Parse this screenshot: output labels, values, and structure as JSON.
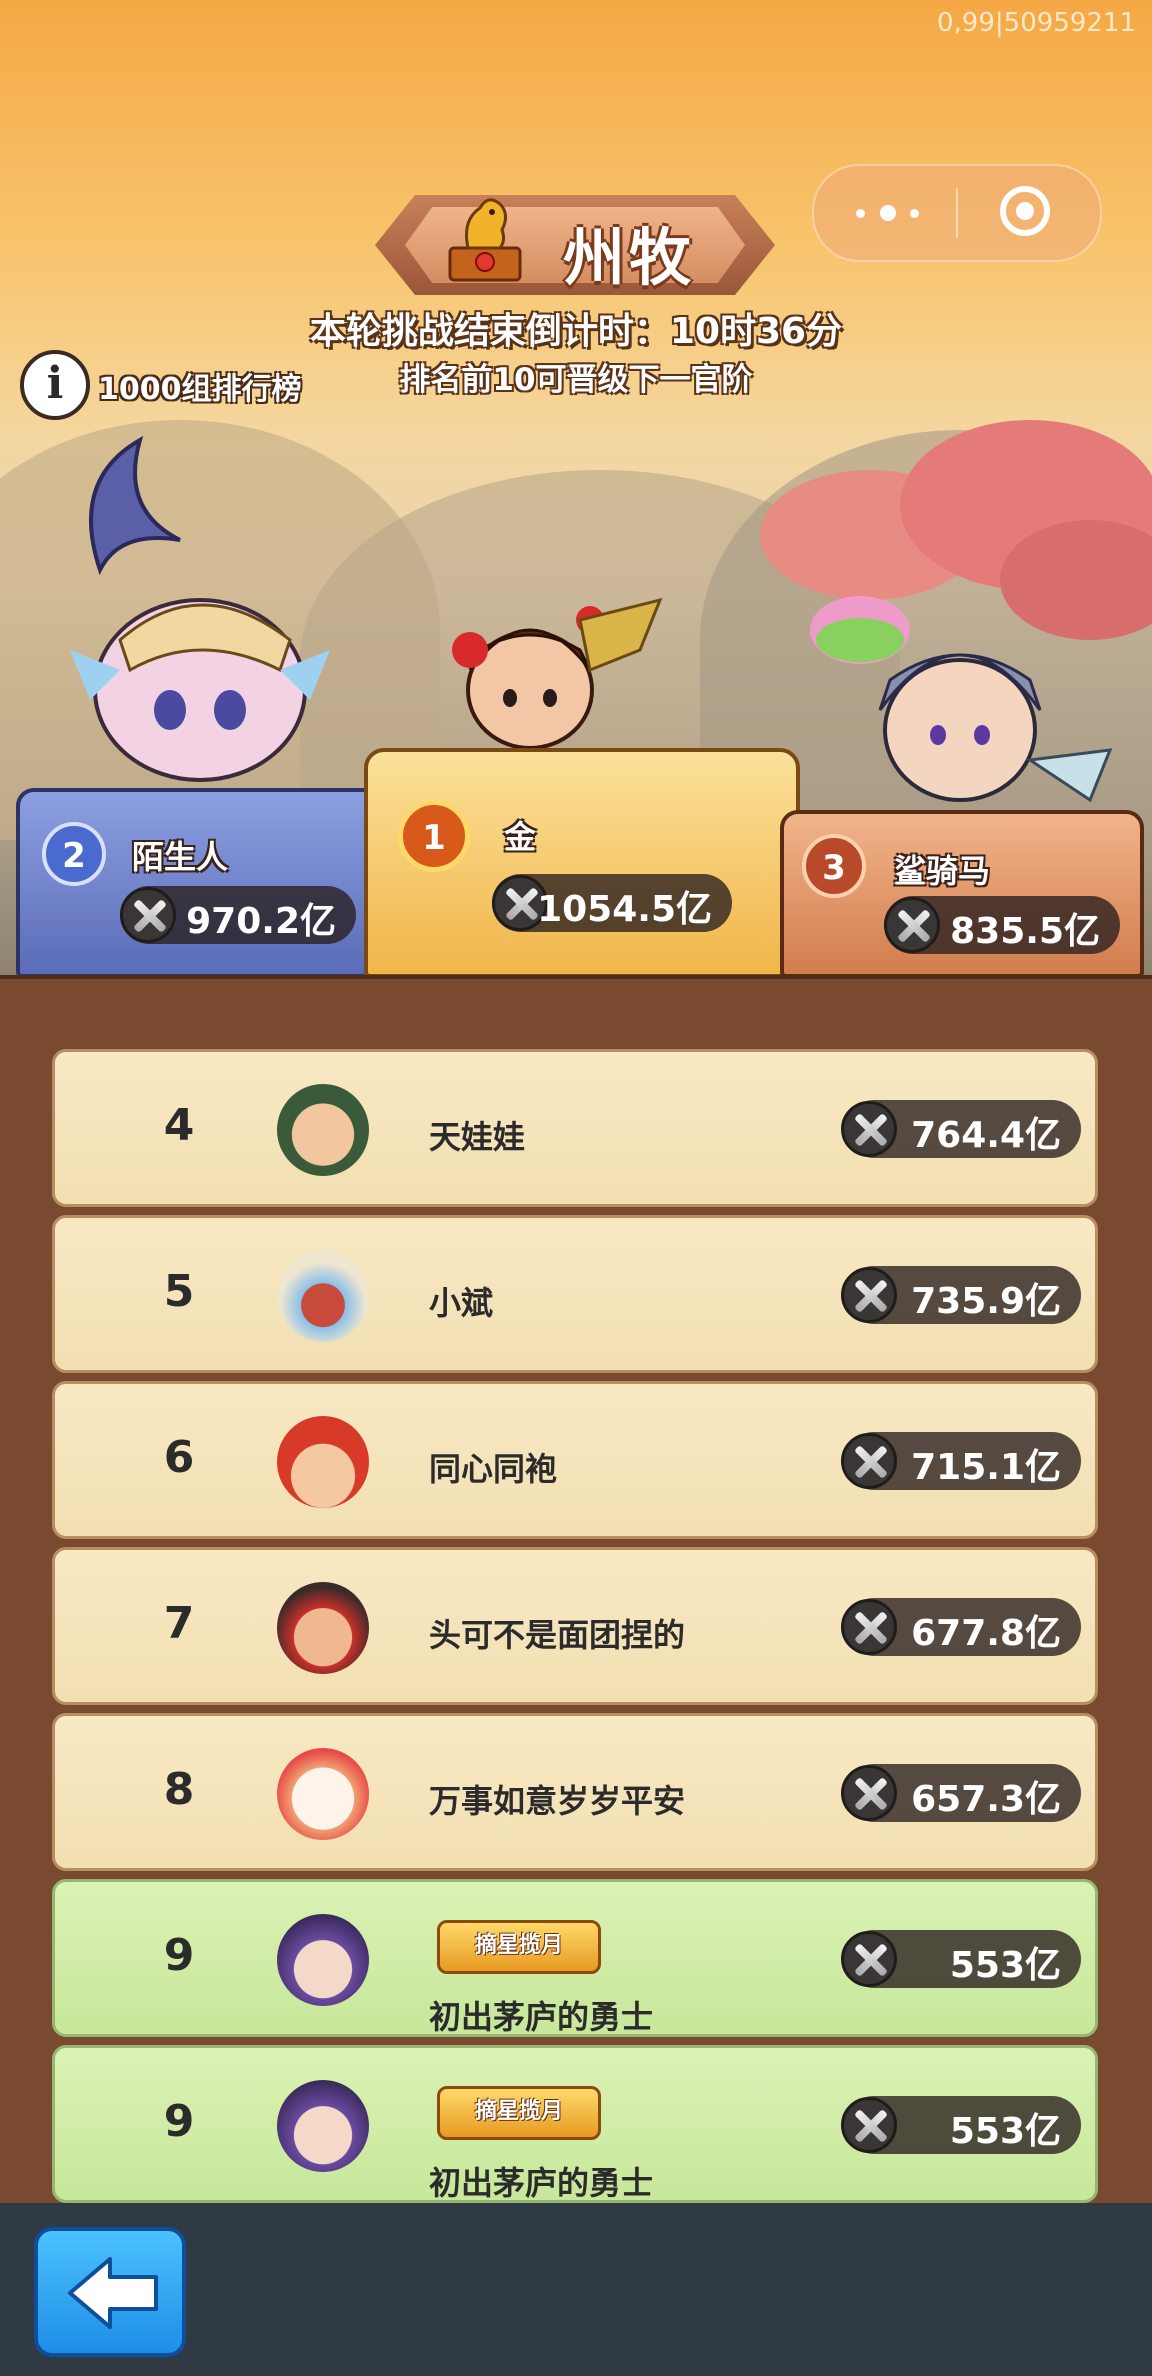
{
  "status": {
    "version_text": "0,99|50959211"
  },
  "header": {
    "rank_title": "州牧",
    "countdown": "本轮挑战结束倒计时：10时36分",
    "promotion_note": "排名前10可晋级下一官阶",
    "leaderboard_label": "1000组排行榜",
    "icons": [
      "trophy-icon",
      "info-icon",
      "more-dots-icon",
      "target-icon"
    ]
  },
  "podium": [
    {
      "rank": "2",
      "name": "陌生人",
      "power": "970.2亿"
    },
    {
      "rank": "1",
      "name": "金",
      "power": "1054.5亿"
    },
    {
      "rank": "3",
      "name": "鲨骑马",
      "power": "835.5亿"
    }
  ],
  "rankings": [
    {
      "rank": "4",
      "name": "天娃娃",
      "power": "764.4亿",
      "badge": ""
    },
    {
      "rank": "5",
      "name": "小斌",
      "power": "735.9亿",
      "badge": ""
    },
    {
      "rank": "6",
      "name": "同心同袍",
      "power": "715.1亿",
      "badge": ""
    },
    {
      "rank": "7",
      "name": "头可不是面团捏的",
      "power": "677.8亿",
      "badge": ""
    },
    {
      "rank": "8",
      "name": "万事如意岁岁平安",
      "power": "657.3亿",
      "badge": ""
    },
    {
      "rank": "9",
      "name": "初出茅庐的勇士",
      "power": "553亿",
      "badge": "摘星揽月"
    },
    {
      "rank": "9",
      "name": "初出茅庐的勇士",
      "power": "553亿",
      "badge": "摘星揽月"
    }
  ],
  "colors": {
    "gold": "#f1b54a",
    "silver": "#5b6cb8",
    "bronze": "#d27d4e",
    "panel": "#7a4a30",
    "row": "#f2dfb2",
    "row_highlight": "#c7e79a",
    "back_button": "#1d8ee6"
  }
}
